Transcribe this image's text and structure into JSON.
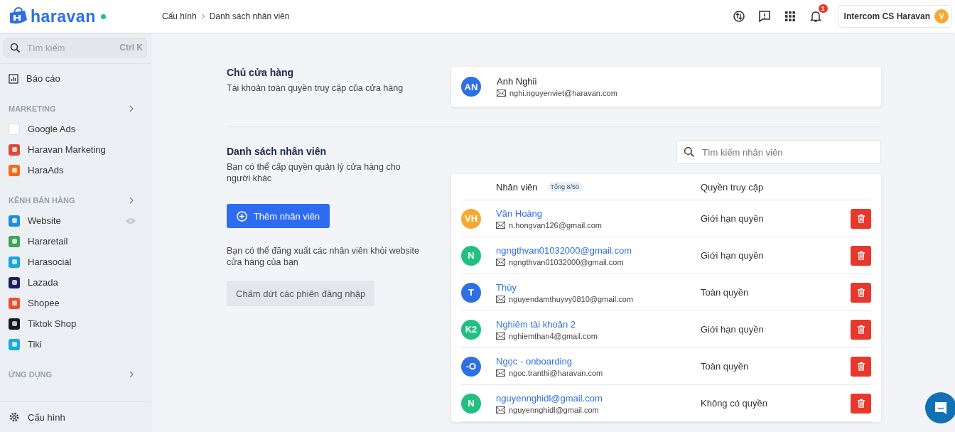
{
  "topbar": {
    "logo": "haravan",
    "breadcrumb": [
      "Cấu hình",
      "Danh sách nhân viên"
    ],
    "notification_count": "1",
    "account": {
      "name": "Intercom CS Haravan",
      "avatar": "V"
    }
  },
  "sidebar": {
    "search": {
      "placeholder": "Tìm kiếm",
      "shortcut": "Ctrl K"
    },
    "top_items": [
      {
        "label": "Báo cáo"
      }
    ],
    "sections": [
      {
        "title": "MARKETING",
        "items": [
          {
            "label": "Google Ads",
            "color": "#ffffff"
          },
          {
            "label": "Haravan Marketing",
            "color": "#e0473e"
          },
          {
            "label": "HaraAds",
            "color": "#f26a1b"
          }
        ]
      },
      {
        "title": "KÊNH BÁN HÀNG",
        "items": [
          {
            "label": "Website",
            "color": "#1d8fe1",
            "visible_toggle": true
          },
          {
            "label": "Hararetail",
            "color": "#3da35d"
          },
          {
            "label": "Harasocial",
            "color": "#18a4e0"
          },
          {
            "label": "Lazada",
            "color": "#1a1d5e"
          },
          {
            "label": "Shopee",
            "color": "#ee4d2d"
          },
          {
            "label": "Tiktok Shop",
            "color": "#161823"
          },
          {
            "label": "Tiki",
            "color": "#1ba8e6"
          }
        ]
      },
      {
        "title": "ỨNG DỤNG"
      }
    ],
    "footer_item": {
      "label": "Cấu hình"
    }
  },
  "owner_section": {
    "title": "Chủ cửa hàng",
    "description": "Tài khoản toàn quyền truy cập của cửa hàng",
    "owner": {
      "initials": "AN",
      "name": "Anh Nghii",
      "email": "nghi.nguyenviet@haravan.com",
      "color": "#2f6fe4"
    }
  },
  "staff_section": {
    "title": "Danh sách nhân viên",
    "description": "Bạn có thể cấp quyền quản lý cửa hàng cho người khác",
    "add_button": "Thêm nhân viên",
    "logout_description": "Bạn có thể đăng xuất các nhân viên khỏi website cửa hàng của bạn",
    "logout_button": "Chấm dứt các phiên đăng nhập",
    "search": {
      "placeholder": "Tìm kiếm nhân viên"
    },
    "table": {
      "columns": [
        "Nhân viên",
        "Quyền truy cập"
      ],
      "total_badge": "Tổng 8/50",
      "rows": [
        {
          "initials": "VH",
          "color": "#f5a933",
          "name": "Vân Hoàng",
          "email": "n.hongvan126@gmail.com",
          "access": "Giới hạn quyền"
        },
        {
          "initials": "N",
          "color": "#22bf83",
          "name": "ngngthvan01032000@gmail.com",
          "email": "ngngthvan01032000@gmail.com",
          "access": "Giới hạn quyền"
        },
        {
          "initials": "T",
          "color": "#2f6fe4",
          "name": "Thùy",
          "email": "nguyendamthuyvy0810@gmail.com",
          "access": "Toàn quyền"
        },
        {
          "initials": "K2",
          "color": "#22bf83",
          "name": "Nghiêm tài khoản 2",
          "email": "nghiemthan4@gmail.com",
          "access": "Giới hạn quyền"
        },
        {
          "initials": "-O",
          "color": "#2f6fe4",
          "name": "Ngọc - onboarding",
          "email": "ngoc.tranthi@haravan.com",
          "access": "Toàn quyền"
        },
        {
          "initials": "N",
          "color": "#22bf83",
          "name": "nguyennghidl@gmail.com",
          "email": "nguyennghidl@gmail.com",
          "access": "Không có quyền"
        }
      ]
    }
  }
}
